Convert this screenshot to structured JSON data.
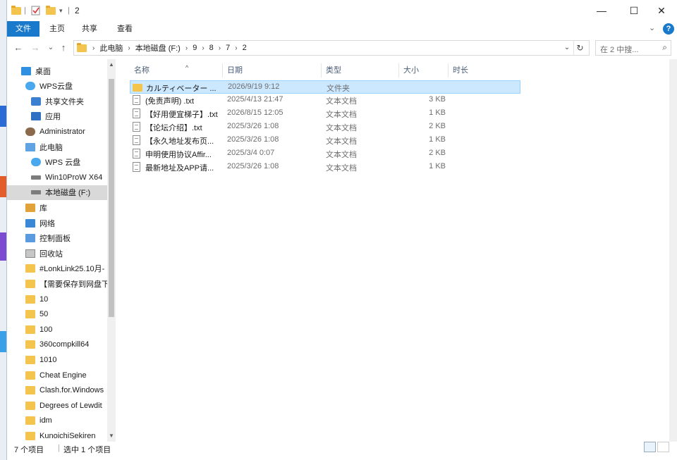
{
  "title": "2",
  "ribbon": {
    "tabs": [
      "文件",
      "主页",
      "共享",
      "查看"
    ],
    "expand": "⌄",
    "help": "?"
  },
  "nav": {
    "back": "←",
    "forward": "→",
    "recent": "⌄",
    "up": "↑",
    "breadcrumb": [
      "此电脑",
      "本地磁盘 (F:)",
      "9",
      "8",
      "7",
      "2"
    ],
    "address_dropdown": "⌄",
    "refresh": "↻",
    "search_placeholder": "在 2 中搜..."
  },
  "window_controls": {
    "minimize": "—",
    "maximize": "☐",
    "close": "✕"
  },
  "sidebar": {
    "items": [
      {
        "label": "桌面",
        "icon": "desktop-icon",
        "indent": 1
      },
      {
        "label": "WPS云盘",
        "icon": "cloud-icon",
        "indent": 2
      },
      {
        "label": "共享文件夹",
        "icon": "shared-folder-icon",
        "indent": 3
      },
      {
        "label": "应用",
        "icon": "apps-icon",
        "indent": 3
      },
      {
        "label": "Administrator",
        "icon": "user-icon",
        "indent": 2
      },
      {
        "label": "此电脑",
        "icon": "computer-icon",
        "indent": 2
      },
      {
        "label": "WPS 云盘",
        "icon": "cloud-icon",
        "indent": 3
      },
      {
        "label": "Win10ProW X64",
        "icon": "drive-icon",
        "indent": 3
      },
      {
        "label": "本地磁盘 (F:)",
        "icon": "drive-icon",
        "indent": 3,
        "selected": true
      },
      {
        "label": "库",
        "icon": "library-icon",
        "indent": 2
      },
      {
        "label": "网络",
        "icon": "network-icon",
        "indent": 2
      },
      {
        "label": "控制面板",
        "icon": "control-panel-icon",
        "indent": 2
      },
      {
        "label": "回收站",
        "icon": "recycle-bin-icon",
        "indent": 2
      },
      {
        "label": "#LonkLink25.10月-",
        "icon": "folder-icon",
        "indent": 2
      },
      {
        "label": "【需要保存到网盘下",
        "icon": "folder-icon",
        "indent": 2
      },
      {
        "label": "10",
        "icon": "folder-icon",
        "indent": 2
      },
      {
        "label": "50",
        "icon": "folder-icon",
        "indent": 2
      },
      {
        "label": "100",
        "icon": "folder-icon",
        "indent": 2
      },
      {
        "label": "360compkill64",
        "icon": "folder-icon",
        "indent": 2
      },
      {
        "label": "1010",
        "icon": "folder-icon",
        "indent": 2
      },
      {
        "label": "Cheat Engine",
        "icon": "folder-icon",
        "indent": 2
      },
      {
        "label": "Clash.for.Windows",
        "icon": "folder-icon",
        "indent": 2
      },
      {
        "label": "Degrees of Lewdit",
        "icon": "folder-icon",
        "indent": 2
      },
      {
        "label": "idm",
        "icon": "folder-icon",
        "indent": 2
      },
      {
        "label": "KunoichiSekiren",
        "icon": "folder-icon",
        "indent": 2
      }
    ]
  },
  "columns": {
    "name": "名称",
    "date": "日期",
    "type": "类型",
    "size": "大小",
    "duration": "时长"
  },
  "files": [
    {
      "name": "カルティベーター ...",
      "date": "2026/9/19 9:12",
      "type": "文件夹",
      "size": "",
      "kind": "folder",
      "selected": true
    },
    {
      "name": "(免责声明) .txt",
      "date": "2025/4/13 21:47",
      "type": "文本文档",
      "size": "3 KB",
      "kind": "file"
    },
    {
      "name": "【好用便宜梯子】.txt",
      "date": "2026/8/15 12:05",
      "type": "文本文档",
      "size": "1 KB",
      "kind": "file"
    },
    {
      "name": "【论坛介绍】.txt",
      "date": "2025/3/26 1:08",
      "type": "文本文档",
      "size": "2 KB",
      "kind": "file"
    },
    {
      "name": "【永久地址发布页...",
      "date": "2025/3/26 1:08",
      "type": "文本文档",
      "size": "1 KB",
      "kind": "file"
    },
    {
      "name": "申明使用协议Affir...",
      "date": "2025/3/4 0:07",
      "type": "文本文档",
      "size": "2 KB",
      "kind": "file"
    },
    {
      "name": "最新地址及APP请...",
      "date": "2025/3/26 1:08",
      "type": "文本文档",
      "size": "1 KB",
      "kind": "file"
    }
  ],
  "status": {
    "count": "7 个项目",
    "selected": "选中 1 个项目"
  },
  "colors": {
    "accent": "#1979ca",
    "selection": "#cce8ff",
    "folder": "#f3c44e"
  }
}
